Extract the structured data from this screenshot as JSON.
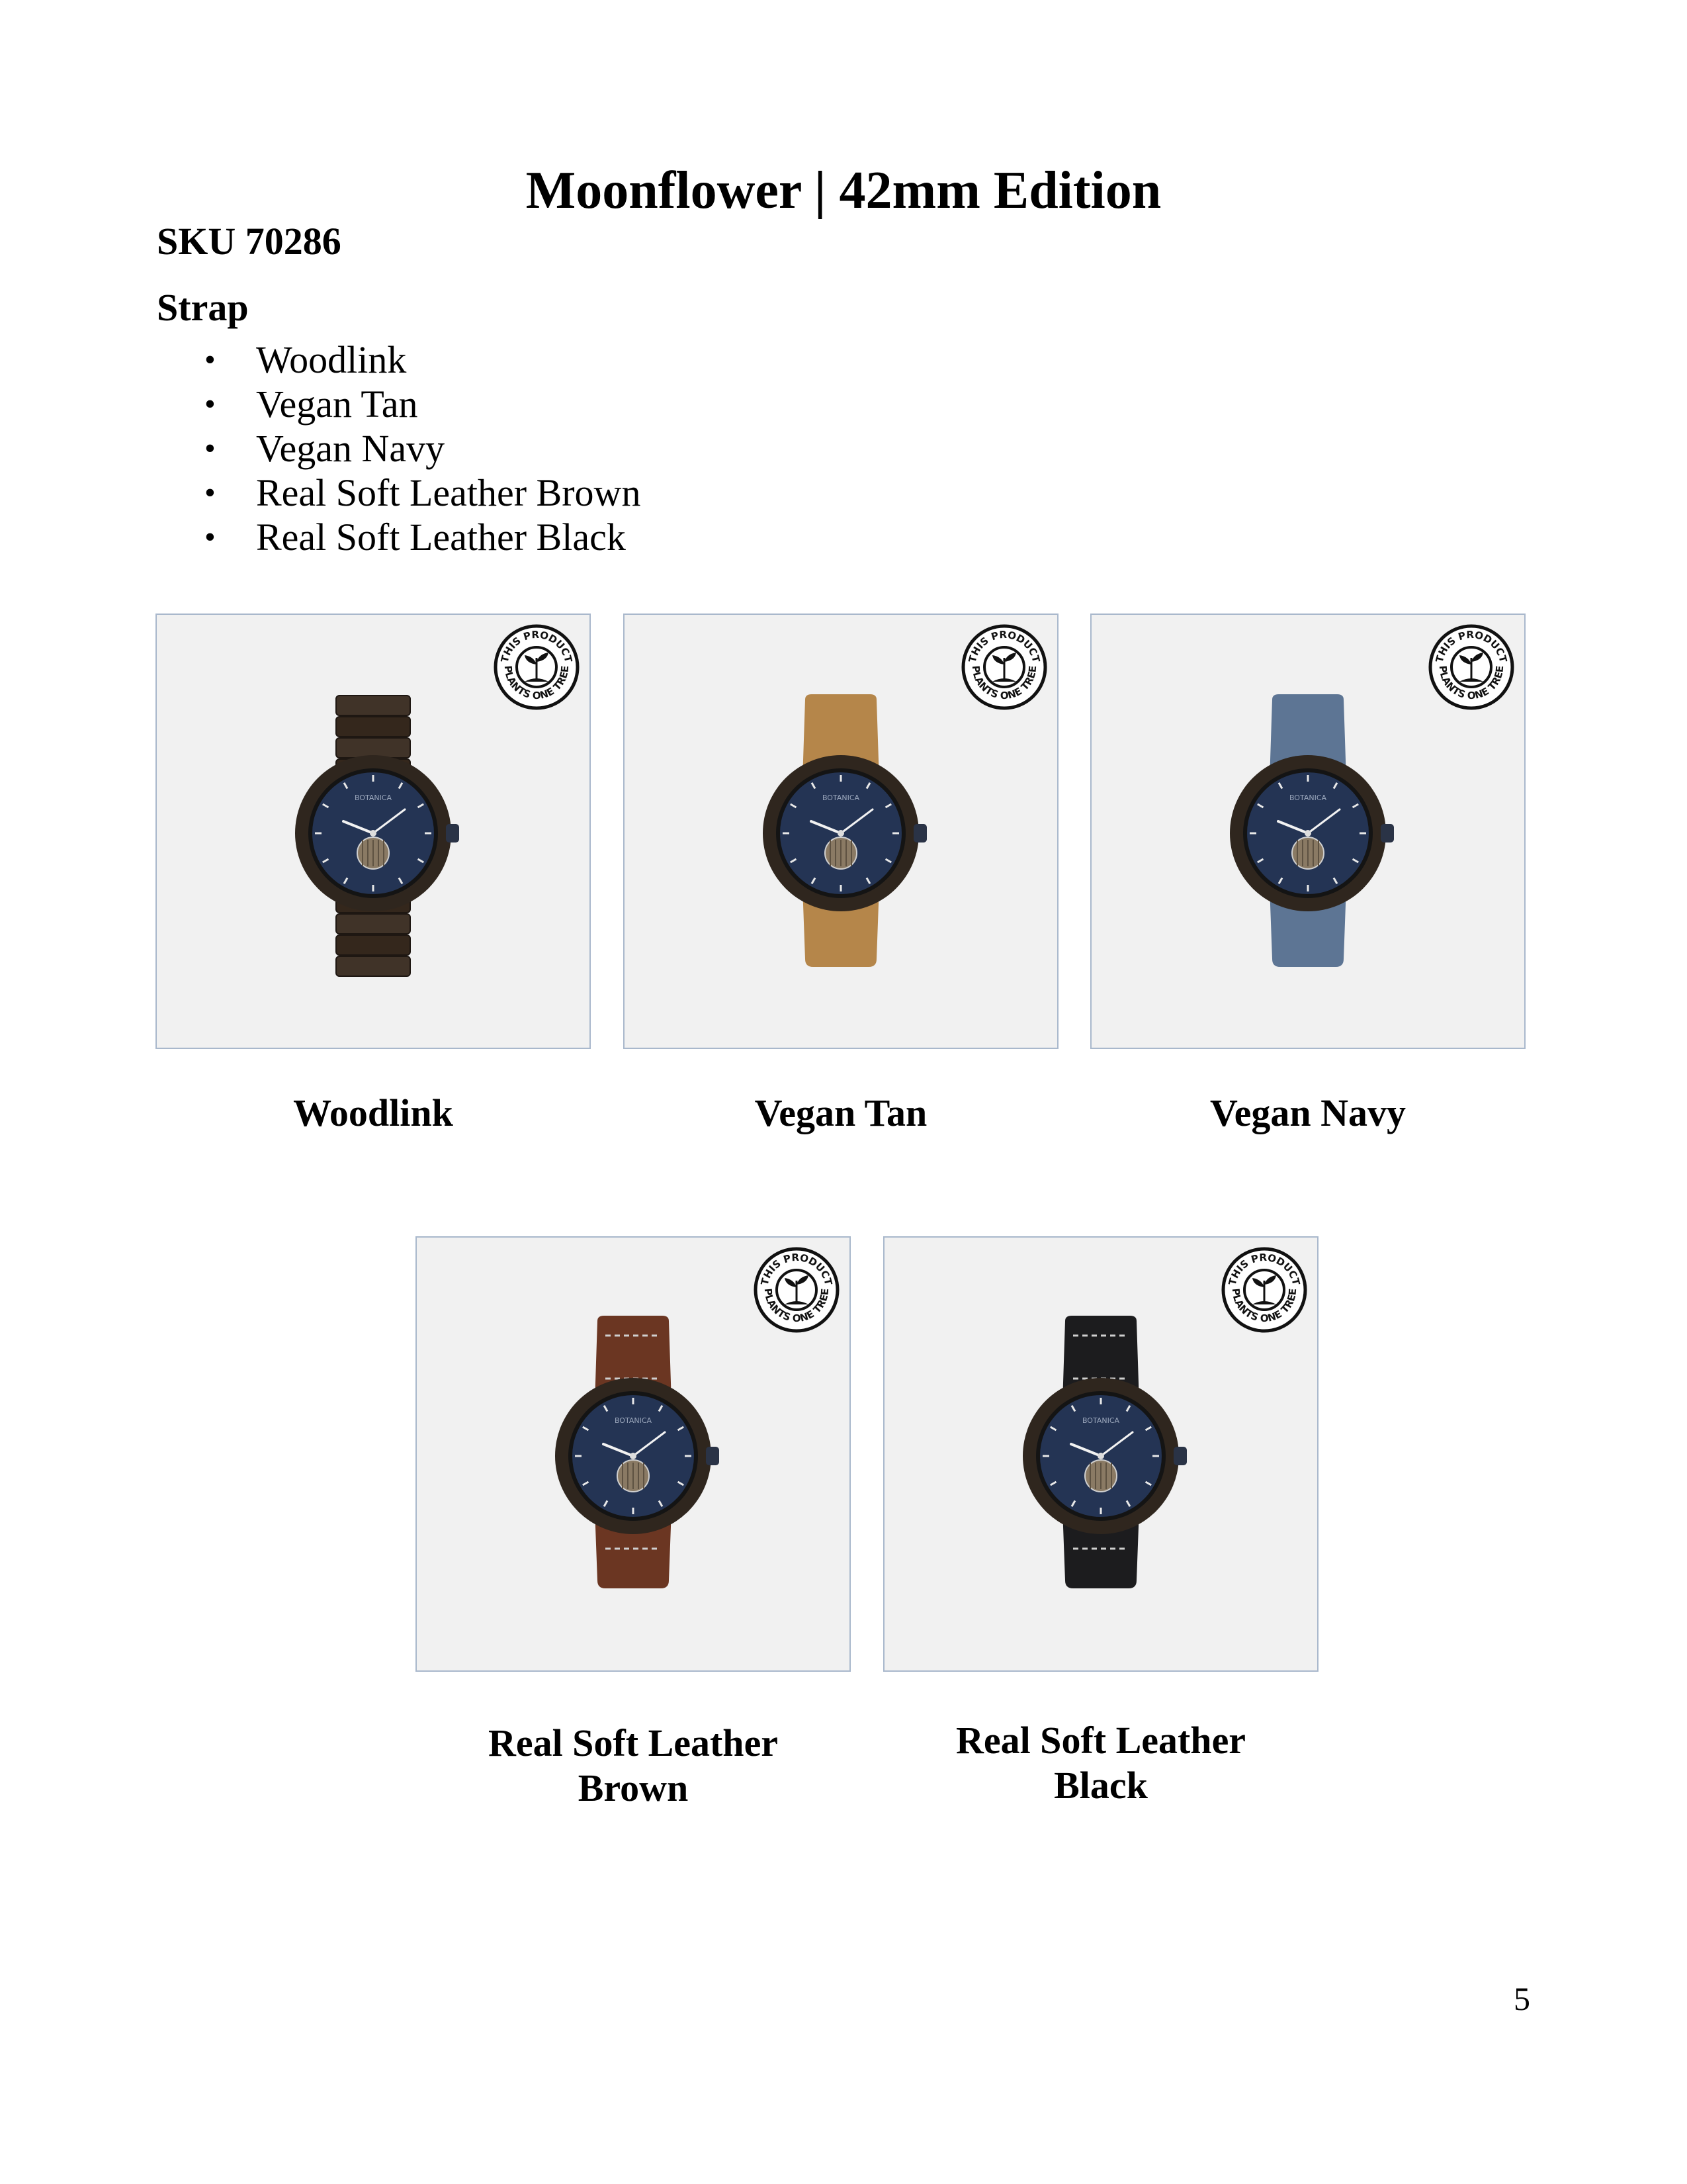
{
  "document": {
    "title": "Moonflower | 42mm Edition",
    "sku": "SKU 70286",
    "strap_heading": "Strap",
    "strap_options": [
      "Woodlink",
      "Vegan Tan",
      "Vegan Navy",
      "Real Soft Leather Brown",
      "Real Soft Leather Black"
    ],
    "page_number": "5"
  },
  "badge": {
    "text_top": "THIS PRODUCT",
    "text_bottom": "PLANTS ONE TREE"
  },
  "watch": {
    "brand": "BOTANICA"
  },
  "products": [
    {
      "caption_line1": "Woodlink",
      "caption_line2": "",
      "strap_color": "#3a2d22",
      "strap_type": "wood"
    },
    {
      "caption_line1": "Vegan Tan",
      "caption_line2": "",
      "strap_color": "#b5864a",
      "strap_type": "suede"
    },
    {
      "caption_line1": "Vegan Navy",
      "caption_line2": "",
      "strap_color": "#5d7594",
      "strap_type": "suede"
    },
    {
      "caption_line1": "Real Soft Leather",
      "caption_line2": "Brown",
      "strap_color": "#6b3622",
      "strap_type": "leather"
    },
    {
      "caption_line1": "Real Soft Leather",
      "caption_line2": "Black",
      "strap_color": "#1c1c1e",
      "strap_type": "leather"
    }
  ],
  "colors": {
    "tile_background": "#f1f1f1",
    "tile_border": "#a9b8cc",
    "dial": "#243454",
    "case": "#2f261e"
  }
}
